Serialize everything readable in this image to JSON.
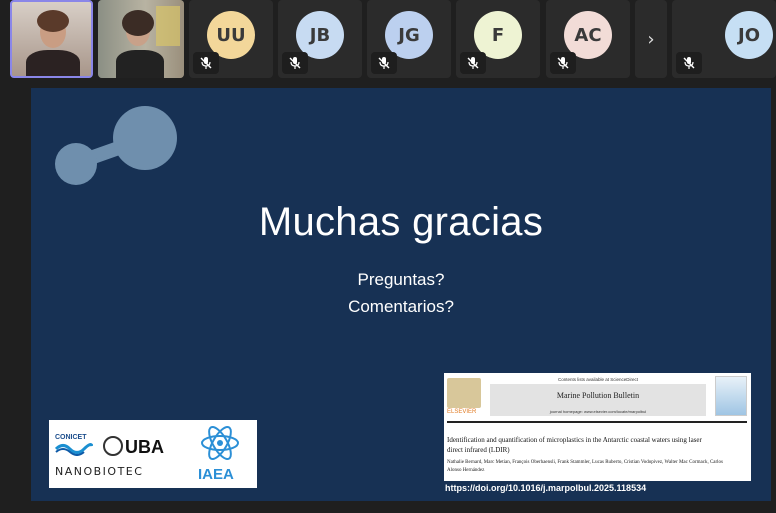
{
  "participants": [
    {
      "type": "video",
      "active": true
    },
    {
      "type": "video",
      "active": false
    },
    {
      "type": "avatar",
      "initials": "UU",
      "color": "#f3d79a"
    },
    {
      "type": "avatar",
      "initials": "JB",
      "color": "#c7dbf2"
    },
    {
      "type": "avatar",
      "initials": "JG",
      "color": "#bcd0ef"
    },
    {
      "type": "avatar",
      "initials": "F",
      "color": "#eef3d3"
    },
    {
      "type": "avatar",
      "initials": "AC",
      "color": "#f2dcd7"
    },
    {
      "type": "avatar",
      "initials": "JO",
      "color": "#c6dff4"
    }
  ],
  "strip": {
    "next_icon": "chevron-right-icon",
    "mic_icon": "mic-off-icon"
  },
  "slide": {
    "title": "Muchas gracias",
    "line1": "Preguntas?",
    "line2": "Comentarios?",
    "doi": "https://doi.org/10.1016/j.marpolbul.2025.118534",
    "logos": {
      "conicet": "CONICET",
      "uba": "UBA",
      "nanobiotec": "NANOBIOTEC",
      "iaea": "IAEA"
    },
    "paper": {
      "contents_line": "Contents lists available at ScienceDirect",
      "journal": "Marine Pollution Bulletin",
      "homepage": "journal homepage: www.elsevier.com/locate/marpolbul",
      "publisher": "ELSEVIER",
      "article_title": "Identification and quantification of microplastics in the Antarctic coastal waters using laser direct infrared (LDIR)",
      "authors": "Nathalie Bernard, Marc Metian, François Oberhaensli, Frank Stammler, Lucas Ruberto, Cristian Vodopivez, Walter Mac Cormack, Carlos Alonso Hernández"
    }
  }
}
